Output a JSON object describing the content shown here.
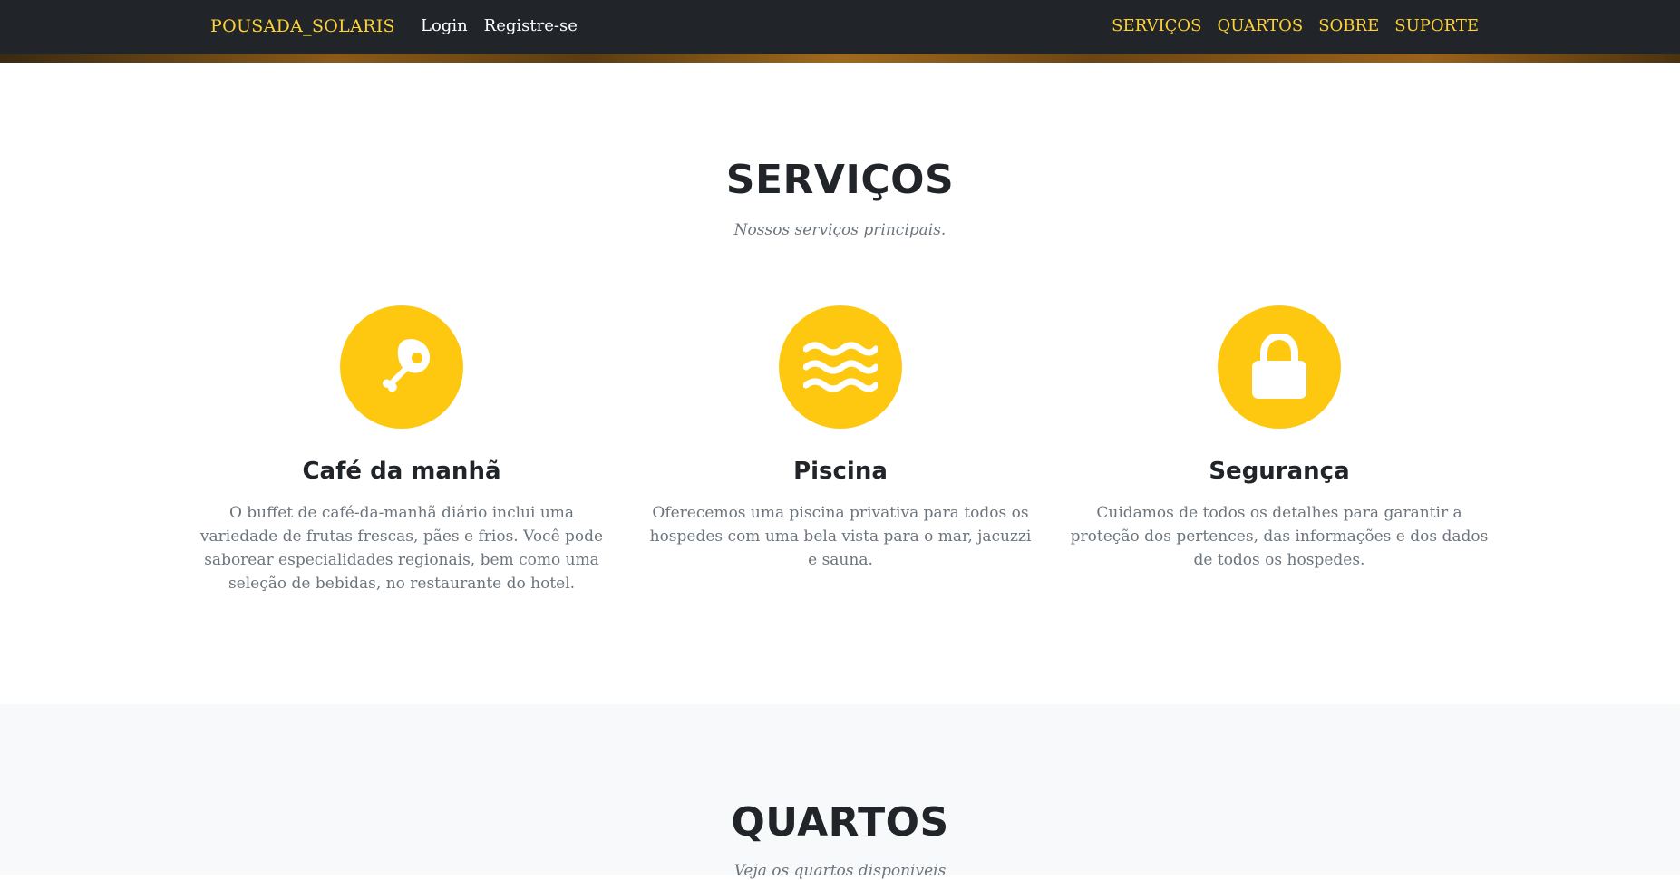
{
  "navbar": {
    "brand": "POUSADA_SOLARIS",
    "left_links": [
      {
        "label": "Login"
      },
      {
        "label": "Registre-se"
      }
    ],
    "right_links": [
      {
        "label": "SERVIÇOS"
      },
      {
        "label": "QUARTOS"
      },
      {
        "label": "SOBRE"
      },
      {
        "label": "SUPORTE"
      }
    ]
  },
  "services": {
    "heading": "SERVIÇOS",
    "subheading": "Nossos serviços principais.",
    "items": [
      {
        "icon": "drumstick-icon",
        "title": "Café da manhã",
        "text": "O buffet de café-da-manhã diário inclui uma variedade de frutas frescas, pães e frios. Você pode saborear especialidades regionais, bem como uma seleção de bebidas, no restaurante do hotel."
      },
      {
        "icon": "water-waves-icon",
        "title": "Piscina",
        "text": "Oferecemos uma piscina privativa para todos os hospedes com uma bela vista para o mar, jacuzzi e sauna."
      },
      {
        "icon": "lock-icon",
        "title": "Segurança",
        "text": "Cuidamos de todos os detalhes para garantir a proteção dos pertences, das informações e dos dados de todos os hospedes."
      }
    ]
  },
  "rooms": {
    "heading": "QUARTOS",
    "subheading": "Veja os quartos disponiveis"
  },
  "colors": {
    "navbar_bg": "#212529",
    "accent": "#fec810",
    "brand_text": "#fed136",
    "heading_text": "#212529",
    "muted_text": "#6c757d",
    "alt_section_bg": "#f8f9fa"
  }
}
